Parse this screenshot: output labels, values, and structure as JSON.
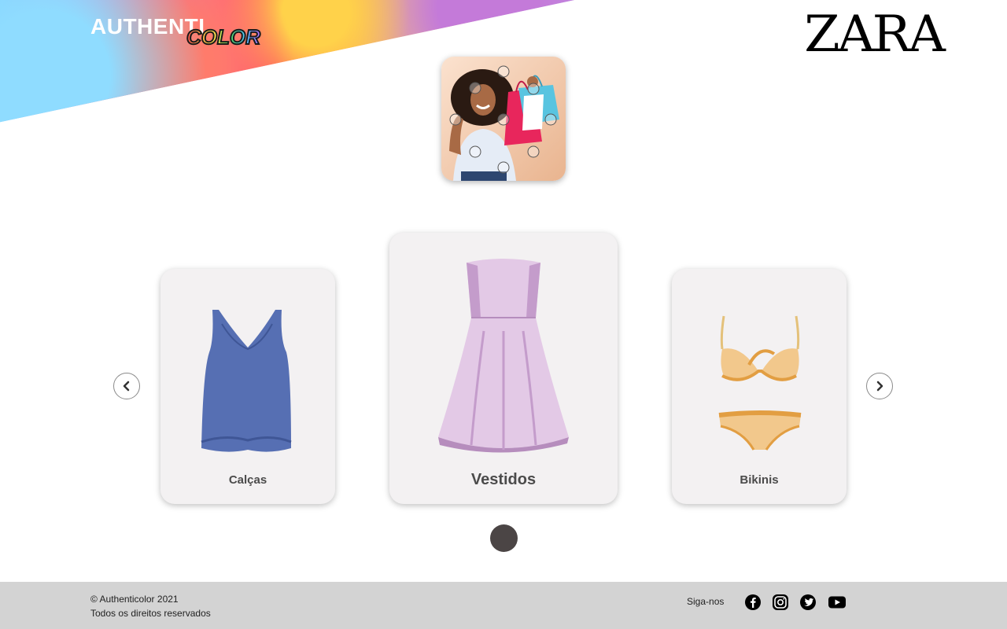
{
  "header": {
    "brand_main": "AUTHENTI",
    "brand_color": "COLOR",
    "partner_logo": "ZARA"
  },
  "hero": {
    "image": "woman-with-shopping-bags"
  },
  "carousel": {
    "items": [
      {
        "label": "Calças",
        "icon": "tank-top-icon",
        "color": "#566fb3"
      },
      {
        "label": "Vestidos",
        "icon": "dress-icon",
        "color": "#e3c9e6"
      },
      {
        "label": "Bikinis",
        "icon": "bikini-icon",
        "color": "#f2c88c"
      }
    ],
    "prev_icon": "chevron-left-icon",
    "next_icon": "chevron-right-icon",
    "active_page": 1
  },
  "footer": {
    "copyright": "© Authenticolor 2021",
    "rights": "Todos os direitos reservados",
    "follow_label": "Siga-nos",
    "social": [
      "facebook-icon",
      "instagram-icon",
      "twitter-icon",
      "youtube-icon"
    ]
  }
}
